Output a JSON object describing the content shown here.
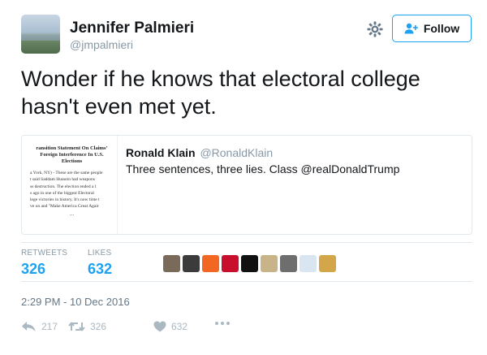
{
  "author": {
    "name": "Jennifer Palmieri",
    "handle": "@jmpalmieri"
  },
  "follow_label": "Follow",
  "tweet_text": "Wonder if he knows that electoral college hasn't even met yet.",
  "quoted": {
    "name": "Ronald Klain",
    "handle": "@RonaldKlain",
    "text": "Three sentences, three lies.  Class @realDonaldTrump",
    "image_title": "ransition Statement On Claims’\nForeign Interference In U.S.\nElections",
    "image_body": "a York, NY) - These are the same people\nt said Saddam Hussein had weapons\nss destruction. The election ended a l\ns ago in one of the biggest Electoral\nlege victories in history. It's now time t\nve on and \"Make America Great Agair",
    "image_dots": "..."
  },
  "stats": {
    "retweets_label": "RETWEETS",
    "retweets_value": "326",
    "likes_label": "LIKES",
    "likes_value": "632"
  },
  "likers": [
    "#7a6a5a",
    "#3b3b3b",
    "#f26722",
    "#c8102e",
    "#111111",
    "#c9b48a",
    "#6e6e6e",
    "#d9e6f2",
    "#d4a64a"
  ],
  "timestamp": "2:29 PM - 10 Dec 2016",
  "actions": {
    "reply": "217",
    "retweet": "326",
    "like": "632"
  },
  "colors": {
    "accent": "#1da1f2",
    "muted": "#8899a6",
    "text": "#14171a",
    "border": "#e1e8ed"
  }
}
